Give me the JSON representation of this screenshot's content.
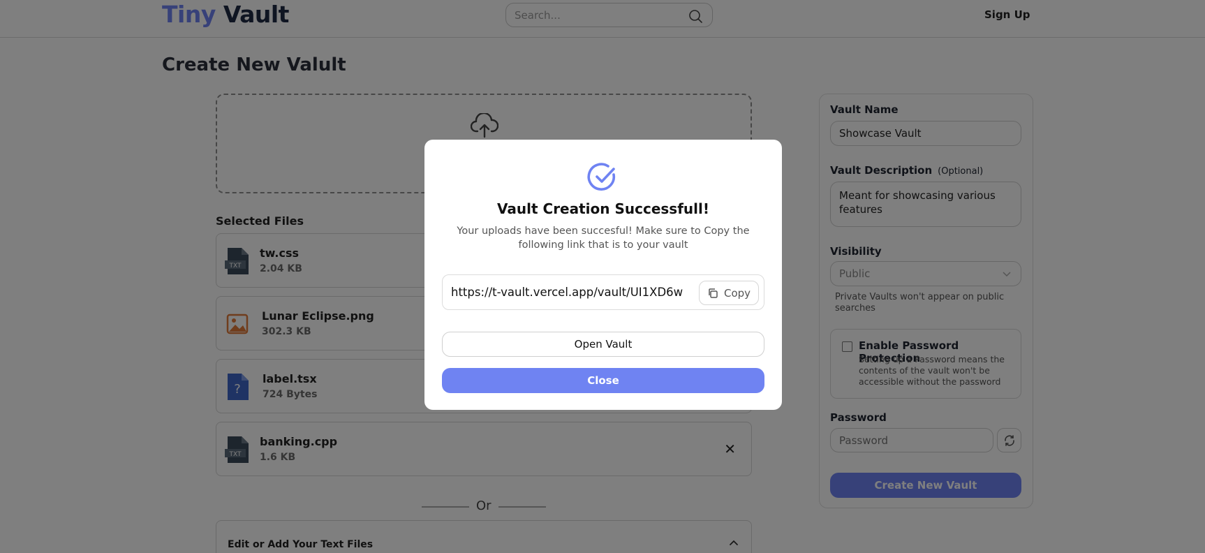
{
  "header": {
    "logo_part1": "Tiny",
    "logo_part2": "Vault",
    "search_placeholder": "Search...",
    "signup_label": "Sign Up"
  },
  "page": {
    "title": "Create New Valult",
    "selected_files_title": "Selected Files",
    "files": [
      {
        "name": "tw.css",
        "size": "2.04 KB",
        "icon": "txt-file-icon"
      },
      {
        "name": "Lunar Eclipse.png",
        "size": "302.3 KB",
        "icon": "image-file-icon"
      },
      {
        "name": "label.tsx",
        "size": "724 Bytes",
        "icon": "unknown-file-icon"
      },
      {
        "name": "banking.cpp",
        "size": "1.6 KB",
        "icon": "txt-file-icon"
      }
    ],
    "close_glyph": "✕",
    "or_text": "Or",
    "text_files_title": "Edit or Add Your Text Files"
  },
  "form": {
    "vault_name_label": "Vault Name",
    "vault_name_value": "Showcase Vault",
    "description_label": "Vault Description",
    "description_optional": "(Optional)",
    "description_value": "Meant for showcasing various features",
    "visibility_label": "Visibility",
    "visibility_value": "Public",
    "visibility_hint": "Private Vaults won't appear on public searches",
    "password_protection_label": "Enable Password Protection",
    "password_protection_desc": "Setting up a Password means the contents of the vault won't be accessible without the password",
    "password_label": "Password",
    "password_placeholder": "Password",
    "create_button": "Create New Vault"
  },
  "modal": {
    "title": "Vault Creation Successfull!",
    "description": "Your uploads have been succesful! Make sure to Copy the following link that is to your vault",
    "url": "https://t-vault.vercel.app/vault/UI1XD6w",
    "copy_label": "Copy",
    "open_label": "Open Vault",
    "close_label": "Close"
  },
  "colors": {
    "accent": "#6f83f2",
    "logo_dark": "#1f2a44",
    "overlay": "rgba(0,0,0,0.5)"
  }
}
